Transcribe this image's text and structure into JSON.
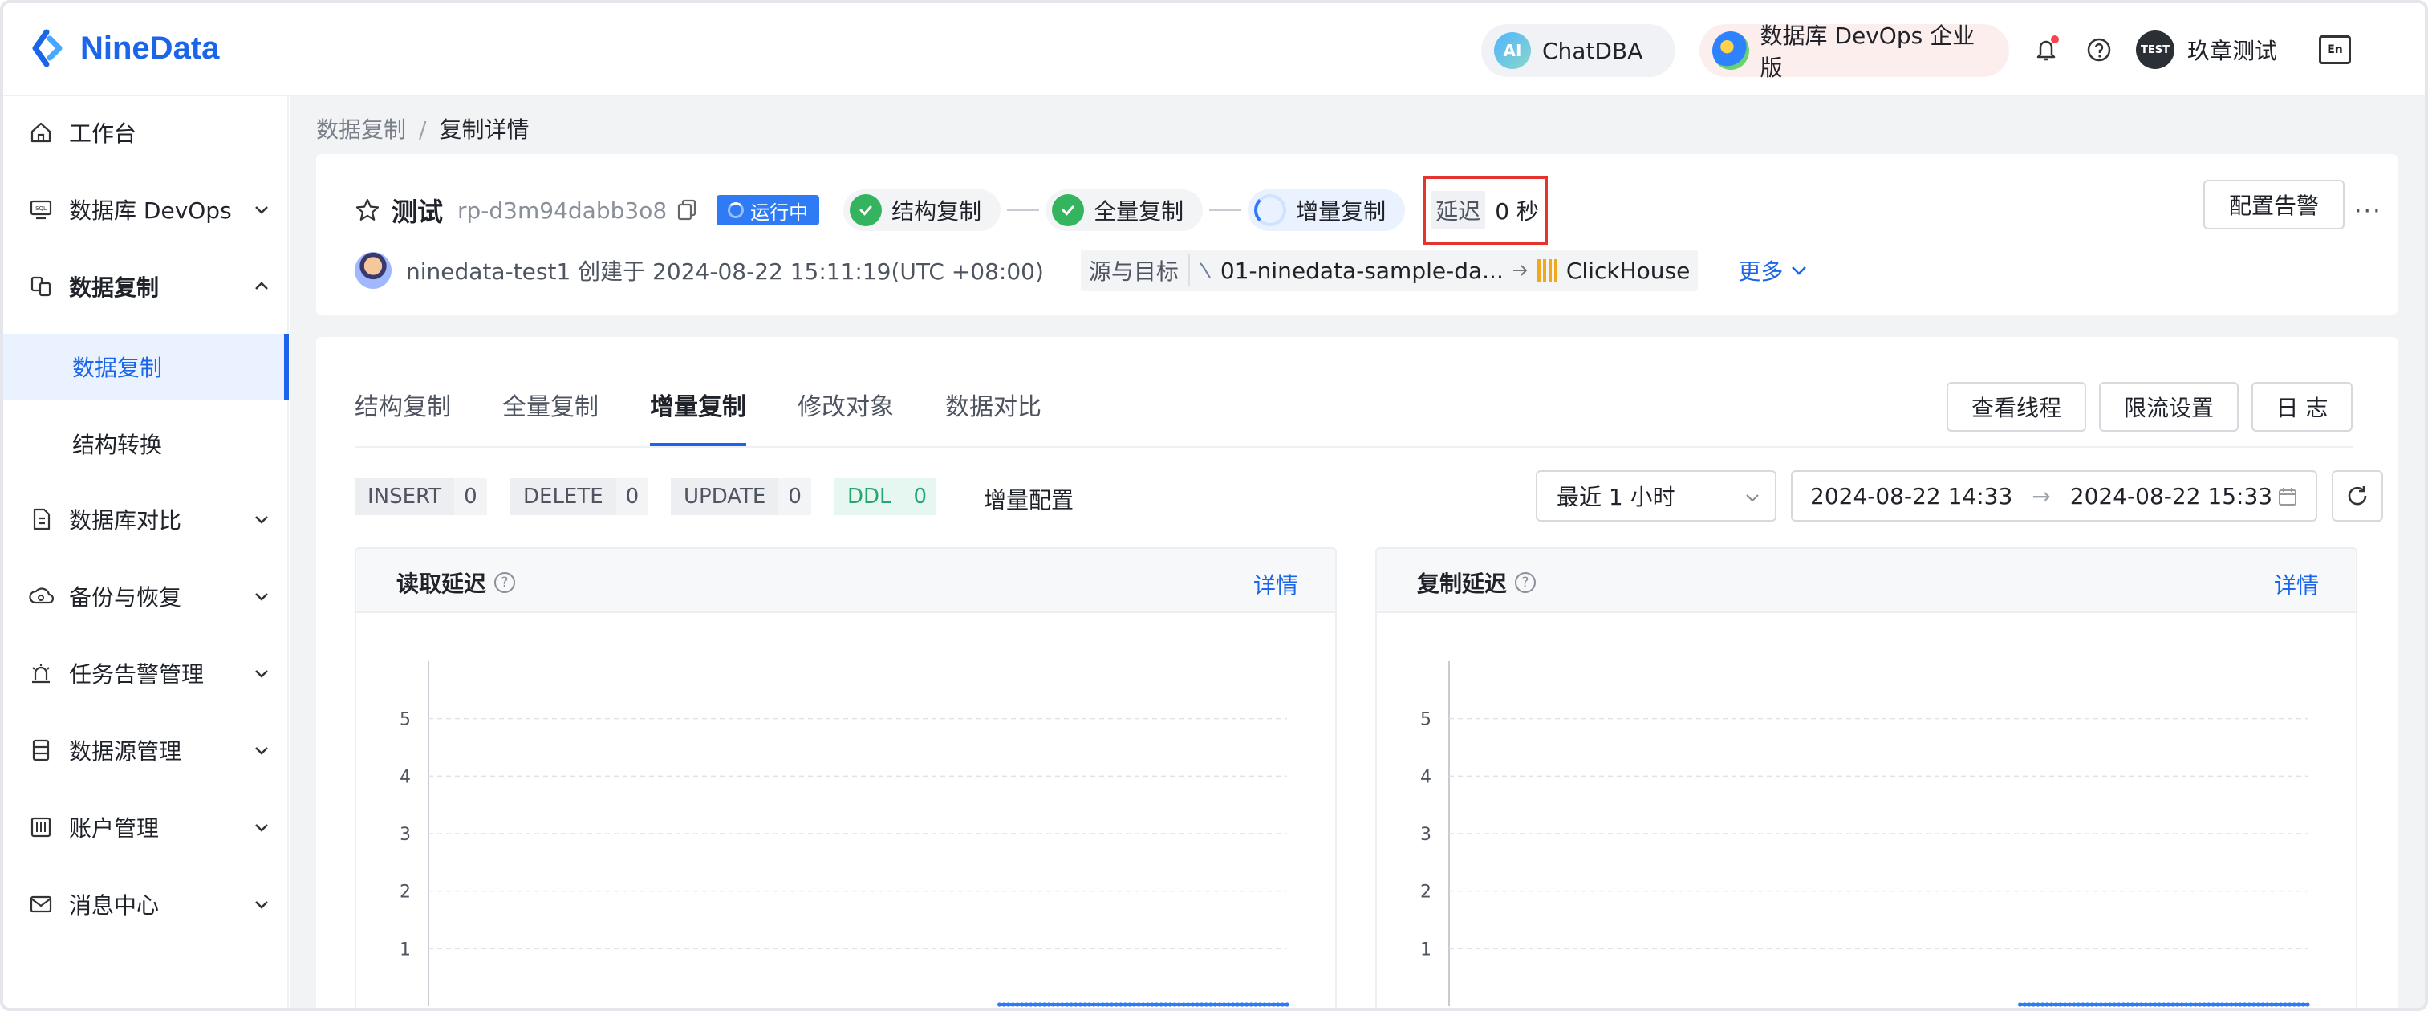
{
  "app": {
    "logo_text": "NineData",
    "brand_color": "#1b66e8"
  },
  "topbar": {
    "chatdba_label": "ChatDBA",
    "chatdba_badge": "AI",
    "devops_label": "数据库 DevOps 企业版",
    "user_avatar_text": "TEST",
    "user_name": "玖章测试",
    "icons": [
      "bell-icon",
      "help-icon",
      "language-icon"
    ]
  },
  "sidebar": {
    "items": [
      {
        "label": "工作台",
        "icon": "home-icon",
        "has_chevron": false
      },
      {
        "label": "数据库 DevOps",
        "icon": "devops-icon",
        "has_chevron": true
      },
      {
        "label": "数据复制",
        "icon": "replication-icon",
        "has_chevron": true,
        "expanded": true
      },
      {
        "label": "数据库对比",
        "icon": "compare-icon",
        "has_chevron": true
      },
      {
        "label": "备份与恢复",
        "icon": "cloud-backup-icon",
        "has_chevron": true
      },
      {
        "label": "任务告警管理",
        "icon": "alarm-icon",
        "has_chevron": true
      },
      {
        "label": "数据源管理",
        "icon": "datasource-icon",
        "has_chevron": true
      },
      {
        "label": "账户管理",
        "icon": "account-icon",
        "has_chevron": true
      },
      {
        "label": "消息中心",
        "icon": "mail-icon",
        "has_chevron": true
      }
    ],
    "sub_items": [
      {
        "label": "数据复制",
        "active": true
      },
      {
        "label": "结构转换",
        "active": false
      }
    ]
  },
  "breadcrumb": {
    "parent": "数据复制",
    "separator": "/",
    "current": "复制详情"
  },
  "task": {
    "name": "测试",
    "id": "rp-d3m94dabb3o8",
    "status": "运行中",
    "stages": [
      "结构复制",
      "全量复制",
      "增量复制"
    ],
    "delay_label": "延迟",
    "delay_value": "0 秒",
    "owner": "ninedata-test1",
    "created_prefix": "创建于",
    "created_at": "2024-08-22 15:11:19(UTC +08:00)",
    "src_dst_label": "源与目标",
    "source": "01-ninedata-sample-da...",
    "target": "ClickHouse",
    "more": "更多",
    "alert_button": "配置告警",
    "more_menu": "···"
  },
  "detail": {
    "tabs": [
      "结构复制",
      "全量复制",
      "增量复制",
      "修改对象",
      "数据对比"
    ],
    "active_tab": 2,
    "buttons": [
      "查看线程",
      "限流设置",
      "日 志"
    ],
    "counters": [
      {
        "key": "INSERT",
        "value": "0"
      },
      {
        "key": "DELETE",
        "value": "0"
      },
      {
        "key": "UPDATE",
        "value": "0"
      },
      {
        "key": "DDL",
        "value": "0"
      }
    ],
    "incr_config": "增量配置",
    "time_select": "最近 1 小时",
    "range_start": "2024-08-22 14:33",
    "range_arrow": "→",
    "range_end": "2024-08-22 15:33"
  },
  "chart_data": [
    {
      "type": "line",
      "title": "读取延迟",
      "link": "详情",
      "y_ticks": [
        "1",
        "2",
        "3",
        "4",
        "5"
      ],
      "ylim": [
        0,
        6
      ],
      "series": [
        {
          "values_visible_tail": 0
        }
      ],
      "grid": true,
      "line_color": "#2f7bf5"
    },
    {
      "type": "line",
      "title": "复制延迟",
      "link": "详情",
      "y_ticks": [
        "1",
        "2",
        "3",
        "4",
        "5"
      ],
      "ylim": [
        0,
        6
      ],
      "series": [
        {
          "values_visible_tail": 0
        }
      ],
      "grid": true,
      "line_color": "#2f7bf5"
    }
  ]
}
